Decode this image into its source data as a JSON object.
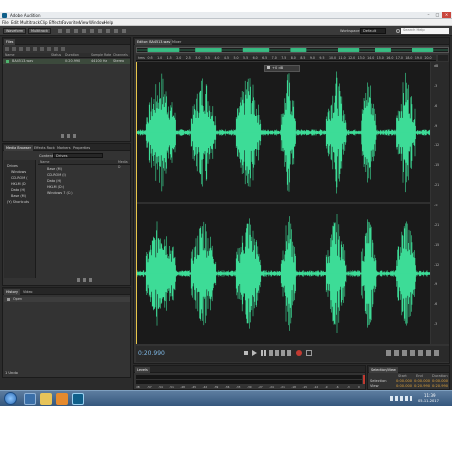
{
  "window": {
    "title": "Adobe Audition",
    "controls": [
      "–",
      "□",
      "×"
    ]
  },
  "menu": [
    "File",
    "Edit",
    "Multitrack",
    "Clip",
    "Effects",
    "Favorites",
    "View",
    "Window",
    "Help"
  ],
  "toolbar": {
    "waveform_label": "Waveform",
    "multitrack_label": "Multitrack",
    "workspace_label": "Workspace:",
    "workspace_value": "Default",
    "search_placeholder": "Search Help"
  },
  "files_panel": {
    "tab": "Files",
    "columns": [
      "Name",
      "Status",
      "Duration",
      "Sample Rate",
      "Channels"
    ],
    "rows": [
      {
        "name": "BA4513.wav",
        "status": "",
        "duration": "0:20.990",
        "sample_rate": "44100 Hz",
        "channels": "Stereo"
      }
    ]
  },
  "media_browser": {
    "tabs": [
      "Media Browser",
      "Effects Rack",
      "Markers",
      "Properties"
    ],
    "contents_label": "Contents:",
    "contents_value": "Drives",
    "left_tree": [
      "Drives",
      "Windows",
      "CD-ROM (",
      "HKLM (D",
      "Data (H)",
      "Base (M)",
      "(Y) Shortcuts"
    ],
    "columns": [
      "Name",
      "Media D"
    ],
    "right_list": [
      "Base (M)",
      "CD-ROM (I)",
      "Data (H)",
      "HKLM (D:)",
      "Windows 7 (C:)"
    ]
  },
  "history_panel": {
    "tabs": [
      "History",
      "Video"
    ],
    "items": [
      "Open"
    ],
    "footer": "1 Undo"
  },
  "editor": {
    "tab": "Editor: BA4513.wav",
    "tab2": "Mixer",
    "hud_value": "+0 dB",
    "time_display": "0:20.990",
    "ruler_labels": [
      "hms",
      "0:5",
      "1.0",
      "1.5",
      "2.0",
      "2.5",
      "3.0",
      "3.5",
      "4.0",
      "4.5",
      "5.0",
      "5.5",
      "6.0",
      "6.5",
      "7.0",
      "7.5",
      "8.0",
      "8.5",
      "9.0",
      "9.5",
      "10.0",
      "11.0",
      "12.0",
      "13.0",
      "14.0",
      "15.0",
      "16.0",
      "17.0",
      "18.0",
      "19.0",
      "20.0"
    ],
    "db_scale": [
      "dB",
      "-3",
      "-6",
      "-9",
      "-12",
      "-15",
      "-21",
      "-∞",
      "-21",
      "-15",
      "-12",
      "-9",
      "-6",
      "-3"
    ],
    "wave_color": "#3ddc97"
  },
  "levels_panel": {
    "tab": "Levels",
    "scale": [
      "dB",
      "-57",
      "-54",
      "-51",
      "-48",
      "-45",
      "-42",
      "-39",
      "-36",
      "-33",
      "-30",
      "-27",
      "-24",
      "-21",
      "-18",
      "-15",
      "-12",
      "-9",
      "-6",
      "-3",
      "0"
    ]
  },
  "selection_panel": {
    "tab": "Selection/View",
    "columns": [
      "Start",
      "End",
      "Duration"
    ],
    "rows": [
      {
        "label": "Selection",
        "start": "0:00.000",
        "end": "0:00.000",
        "duration": "0:00.000"
      },
      {
        "label": "View",
        "start": "0:00.000",
        "end": "0:20.990",
        "duration": "0:20.990"
      }
    ]
  },
  "status_bar": {
    "left": "Stopped",
    "right": "44100 Hz • 16-bit • Stereo",
    "size": "3.53 MB",
    "duration": "0:20.990",
    "free": "186.95 GB free"
  },
  "taskbar": {
    "time": "11:39",
    "date": "05-11-2017"
  }
}
